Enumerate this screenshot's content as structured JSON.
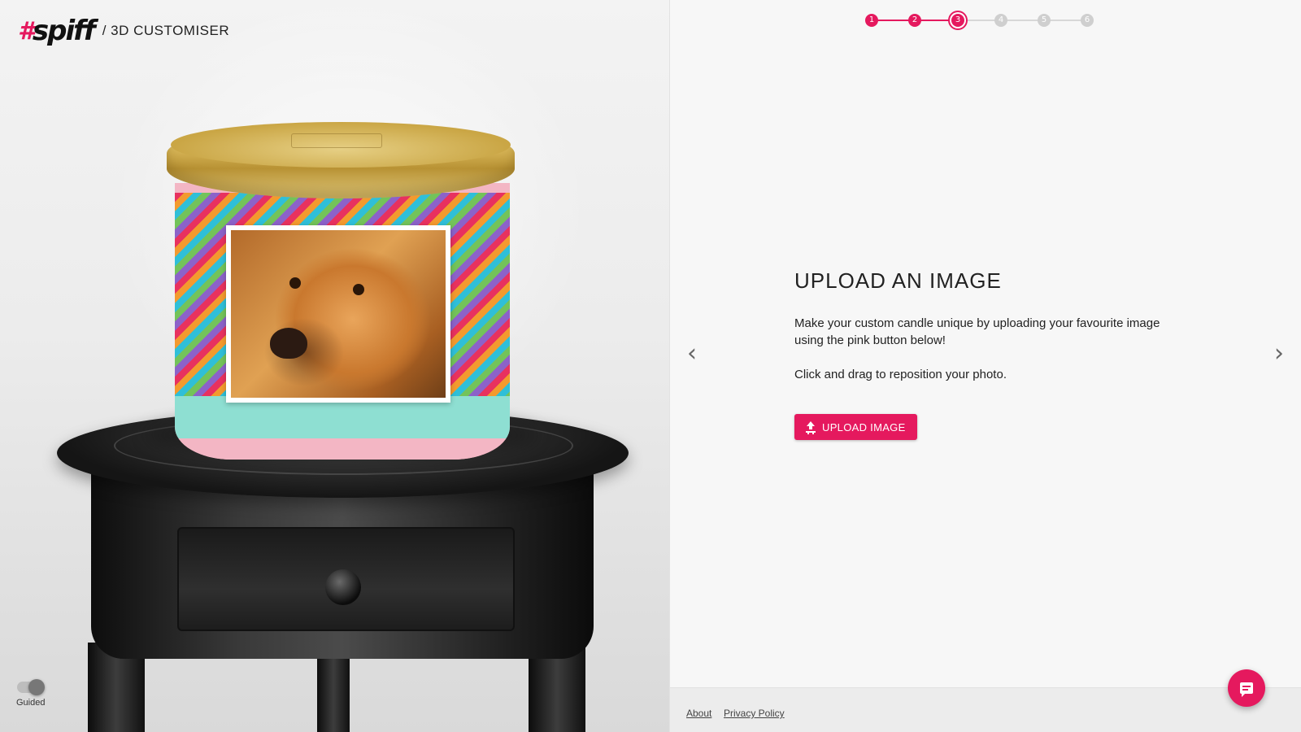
{
  "brand": {
    "hash": "#",
    "name": "spiff",
    "subtitle": "/ 3D CUSTOMISER"
  },
  "colors": {
    "accent": "#e5195e",
    "inactive_step": "#cfcfcf"
  },
  "stepper": {
    "current": 3,
    "steps": [
      "1",
      "2",
      "3",
      "4",
      "5",
      "6"
    ]
  },
  "main": {
    "title": "UPLOAD AN IMAGE",
    "description": "Make your custom candle unique by uploading your favourite image using the pink button below!",
    "hint": "Click and drag to reposition your photo.",
    "upload_label": "UPLOAD IMAGE"
  },
  "nav": {
    "prev_icon": "‹",
    "next_icon": "›"
  },
  "guided": {
    "label": "Guided",
    "enabled": true
  },
  "footer": {
    "about": "About",
    "privacy": "Privacy Policy"
  },
  "icons": {
    "upload": "upload-icon",
    "chat": "chat-icon",
    "prev": "chevron-left-icon",
    "next": "chevron-right-icon"
  }
}
